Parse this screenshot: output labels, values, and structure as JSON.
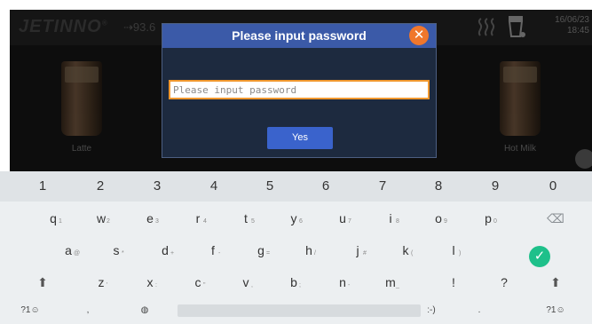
{
  "topbar": {
    "logo": "JETINNO",
    "logo_mark": "®",
    "temperature": "⇢93.6",
    "date": "16/06/23",
    "time": "18:45"
  },
  "drinks": [
    {
      "label": "Latte"
    },
    {
      "label": "Hot Milk"
    }
  ],
  "dialog": {
    "title": "Please input password",
    "close_symbol": "✕",
    "input_placeholder": "Please input password",
    "input_value": "",
    "confirm_label": "Yes"
  },
  "keyboard": {
    "numbers": [
      "1",
      "2",
      "3",
      "4",
      "5",
      "6",
      "7",
      "8",
      "9",
      "0"
    ],
    "row1": [
      {
        "key": "q",
        "hint": "1"
      },
      {
        "key": "w",
        "hint": "2"
      },
      {
        "key": "e",
        "hint": "3"
      },
      {
        "key": "r",
        "hint": "4"
      },
      {
        "key": "t",
        "hint": "5"
      },
      {
        "key": "y",
        "hint": "6"
      },
      {
        "key": "u",
        "hint": "7"
      },
      {
        "key": "i",
        "hint": "8"
      },
      {
        "key": "o",
        "hint": "9"
      },
      {
        "key": "p",
        "hint": "0"
      }
    ],
    "row2": [
      {
        "key": "a",
        "hint": "@"
      },
      {
        "key": "s",
        "hint": "*"
      },
      {
        "key": "d",
        "hint": "+"
      },
      {
        "key": "f",
        "hint": "-"
      },
      {
        "key": "g",
        "hint": "="
      },
      {
        "key": "h",
        "hint": "/"
      },
      {
        "key": "j",
        "hint": "#"
      },
      {
        "key": "k",
        "hint": "("
      },
      {
        "key": "l",
        "hint": ")"
      }
    ],
    "row3": [
      {
        "key": "z",
        "hint": "'"
      },
      {
        "key": "x",
        "hint": ":"
      },
      {
        "key": "c",
        "hint": "\""
      },
      {
        "key": "v",
        "hint": ","
      },
      {
        "key": "b",
        "hint": ";"
      },
      {
        "key": "n",
        "hint": "-"
      },
      {
        "key": "m",
        "hint": "_"
      },
      {
        "key": "!",
        "hint": ""
      },
      {
        "key": "?",
        "hint": ""
      }
    ],
    "backspace": "⌫",
    "shift": "⬆",
    "done": "✓",
    "symbols_left": "?1☺",
    "comma": ",",
    "globe": "◍",
    "emoticon": ":-)",
    "period": ".",
    "symbols_right": "?1☺"
  },
  "colors": {
    "dialog_header": "#3b5aa8",
    "close_button": "#f0772c",
    "input_border": "#f0982f",
    "yes_button": "#3a63cc",
    "done_button": "#1ec08a"
  }
}
